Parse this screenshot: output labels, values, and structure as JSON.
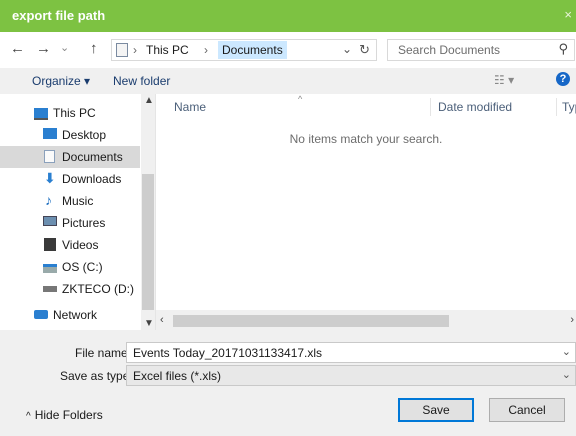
{
  "window": {
    "title": "export file path",
    "close_glyph": "×"
  },
  "address_bar": {
    "back_glyph": "←",
    "forward_glyph": "→",
    "recent_glyph": "⌄",
    "up_glyph": "↑",
    "breadcrumb": [
      "This PC",
      "Documents"
    ],
    "breadcrumb_separator": "›",
    "dropdown_glyph": "⌄",
    "refresh_glyph": "↻",
    "search_placeholder": "Search Documents",
    "search_glyph": "⚲"
  },
  "toolbar": {
    "organize_label": "Organize ▾",
    "new_folder_label": "New folder",
    "view_glyph": "☷ ▾",
    "help_glyph": "?"
  },
  "nav": {
    "items": [
      {
        "label": "This PC",
        "icon": "computer-icon",
        "color": "#2a7fd0"
      },
      {
        "label": "Desktop",
        "icon": "desktop-icon",
        "color": "#2a7fd0"
      },
      {
        "label": "Documents",
        "icon": "documents-icon",
        "color": "#8aa0bb",
        "selected": true
      },
      {
        "label": "Downloads",
        "icon": "downloads-icon",
        "color": "#2a7fd0"
      },
      {
        "label": "Music",
        "icon": "music-icon",
        "color": "#1e6fc0"
      },
      {
        "label": "Pictures",
        "icon": "pictures-icon",
        "color": "#6c8fb0"
      },
      {
        "label": "Videos",
        "icon": "videos-icon",
        "color": "#3a3a3a"
      },
      {
        "label": "OS (C:)",
        "icon": "drive-icon",
        "color": "#2a7fd0"
      },
      {
        "label": "ZKTECO (D:)",
        "icon": "drive-icon",
        "color": "#777777"
      },
      {
        "label": "Network",
        "icon": "network-icon",
        "color": "#2a7fd0"
      }
    ]
  },
  "file_list": {
    "columns": [
      "Name",
      "Date modified",
      "Typ"
    ],
    "empty_message": "No items match your search."
  },
  "file_name": {
    "label": "File name:",
    "value": "Events Today_20171031133417.xls"
  },
  "save_as_type": {
    "label": "Save as type:",
    "value": "Excel files (*.xls)"
  },
  "footer": {
    "hide_folders_label": "Hide Folders",
    "hide_arrow_glyph": "^",
    "save_label": "Save",
    "cancel_label": "Cancel"
  },
  "colors": {
    "title_bar": "#7dc242",
    "selection": "#cce8ff",
    "help_icon": "#1667c7",
    "default_button_border": "#0078d7"
  }
}
